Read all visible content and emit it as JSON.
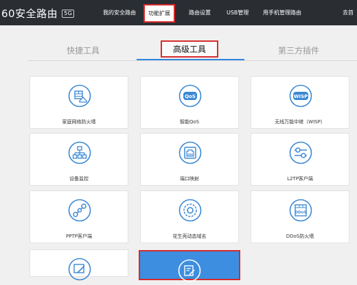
{
  "topbar": {
    "brand": "60安全路由",
    "brand_badge": "5G",
    "nav": [
      {
        "label": "我的安全路由"
      },
      {
        "label": "功能扩展"
      },
      {
        "label": "路由设置"
      },
      {
        "label": "USB管理"
      },
      {
        "label": "用手机管理路由"
      },
      {
        "label": "去首"
      }
    ]
  },
  "subtabs": [
    {
      "label": "快捷工具"
    },
    {
      "label": "高级工具"
    },
    {
      "label": "第三方插件"
    }
  ],
  "tools": [
    {
      "label": "家庭网络防火墙",
      "icon": "home-firewall-icon"
    },
    {
      "label": "智能QoS",
      "icon": "qos-icon",
      "icon_text": "QoS"
    },
    {
      "label": "无线万能中继（WISP）",
      "icon": "wisp-icon",
      "icon_text": "WISP"
    },
    {
      "label": "设备监控",
      "icon": "network-tree-icon"
    },
    {
      "label": "端口映射",
      "icon": "ethernet-port-icon"
    },
    {
      "label": "L2TP客户端",
      "icon": "slider-settings-icon"
    },
    {
      "label": "PPTP客户端",
      "icon": "vpn-link-icon"
    },
    {
      "label": "花生壳动态域名",
      "icon": "peanut-dns-icon"
    },
    {
      "label": "DDoS防火墙",
      "icon": "ddos-firewall-icon",
      "icon_text": "DDoS"
    }
  ],
  "colors": {
    "topbar_bg": "#2a2e33",
    "accent_blue": "#2e86de",
    "icon_blue": "#3b88d4",
    "highlight_card": "#3d8ee0",
    "annotation_red": "#d62b2b"
  }
}
